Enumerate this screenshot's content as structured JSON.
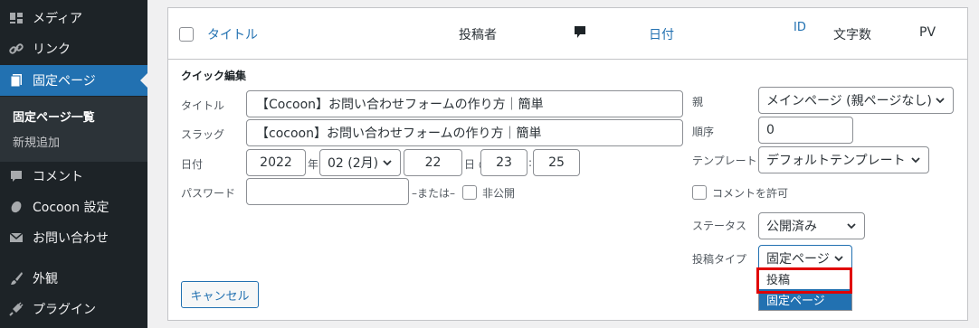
{
  "sidebar": {
    "items": [
      {
        "label": "メディア",
        "icon": "media-icon"
      },
      {
        "label": "リンク",
        "icon": "link-icon"
      },
      {
        "label": "固定ページ",
        "icon": "pages-icon"
      },
      {
        "label": "コメント",
        "icon": "comment-icon"
      },
      {
        "label": "Cocoon 設定",
        "icon": "cocoon-icon"
      },
      {
        "label": "お問い合わせ",
        "icon": "mail-icon"
      },
      {
        "label": "外観",
        "icon": "brush-icon"
      },
      {
        "label": "プラグイン",
        "icon": "plugin-icon"
      }
    ],
    "submenu": [
      "固定ページ一覧",
      "新規追加"
    ],
    "active_color": "#2271b1"
  },
  "table_header": {
    "title": "タイトル",
    "author": "投稿者",
    "date": "日付",
    "id": "ID",
    "chars": "文字数",
    "pv": "PV"
  },
  "quick_edit": {
    "heading": "クイック編集",
    "title_label": "タイトル",
    "title_value": "【Cocoon】お問い合わせフォームの作り方｜簡単",
    "slug_label": "スラッグ",
    "slug_value": "【cocoon】お問い合わせフォームの作り方｜簡単",
    "date_label": "日付",
    "year": "2022",
    "year_suffix": "年",
    "month": "02 (2月)",
    "day": "22",
    "day_suffix": "日 @",
    "hour": "23",
    "time_sep": ":",
    "minute": "25",
    "password_label": "パスワード",
    "or_text": "–または–",
    "private_label": "非公開",
    "parent_label": "親",
    "parent_value": "メインページ (親ページなし)",
    "order_label": "順序",
    "order_value": "0",
    "template_label": "テンプレート",
    "template_value": "デフォルトテンプレート",
    "allow_comments_label": "コメントを許可",
    "status_label": "ステータス",
    "status_value": "公開済み",
    "post_type_label": "投稿タイプ",
    "post_type_value": "固定ページ",
    "post_type_options": [
      "投稿",
      "固定ページ"
    ],
    "cancel_label": "キャンセル"
  },
  "highlight_color": "#e00000"
}
